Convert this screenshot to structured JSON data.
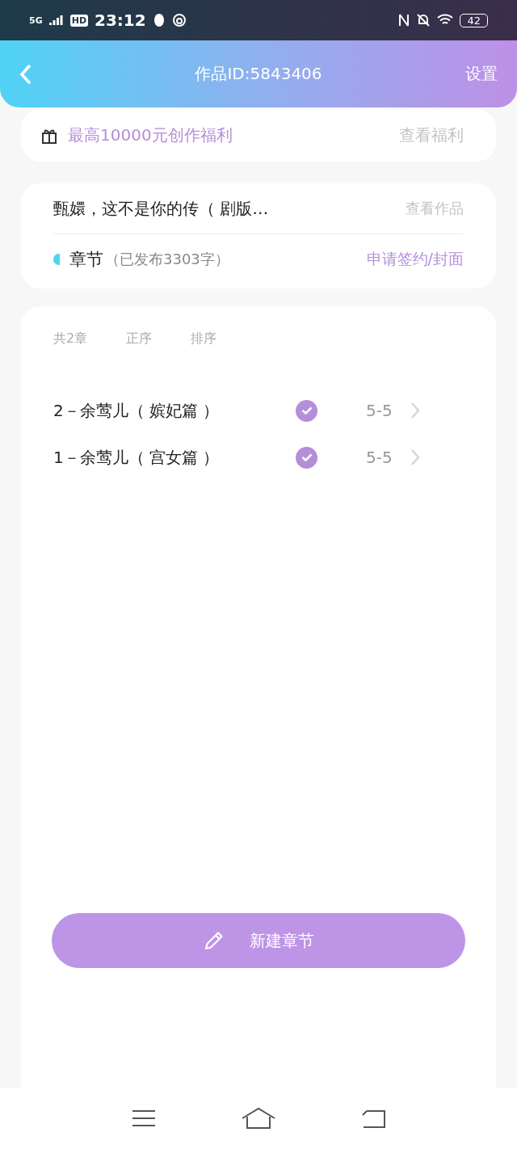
{
  "status_bar": {
    "network": "5G",
    "hd": "HD",
    "time": "23:12",
    "battery": "42"
  },
  "header": {
    "title": "作品ID:5843406",
    "action": "设置"
  },
  "benefit": {
    "text": "最高10000元创作福利",
    "link": "查看福利"
  },
  "work": {
    "title": "甄嬛，这不是你的传（ 剧版…",
    "link": "查看作品",
    "section": "章节",
    "published_info": "（已发布3303字）",
    "action": "申请签约/封面"
  },
  "chapters": {
    "count": "共2章",
    "order": "正序",
    "sort": "排序",
    "rows": [
      {
        "title": "2－余莺儿（ 嫔妃篇 ）",
        "published": true,
        "date": "5-5"
      },
      {
        "title": "1－余莺儿（ 宫女篇 ）",
        "published": true,
        "date": "5-5"
      }
    ]
  },
  "new_button": "新建章节"
}
